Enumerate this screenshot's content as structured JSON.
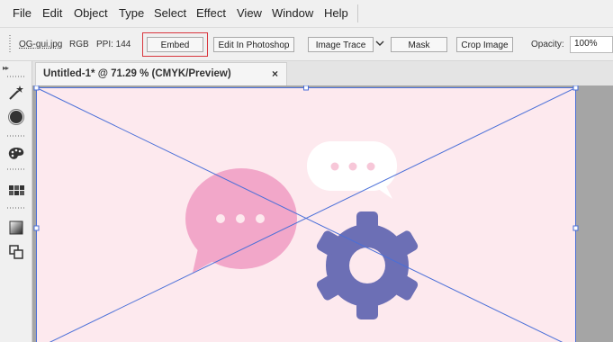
{
  "menu": {
    "items": [
      "File",
      "Edit",
      "Object",
      "Type",
      "Select",
      "Effect",
      "View",
      "Window",
      "Help"
    ]
  },
  "control_bar": {
    "filename": "OG-gui.jpg",
    "color_mode": "RGB",
    "ppi": "PPI: 144",
    "embed_label": "Embed",
    "edit_photoshop_label": "Edit In Photoshop",
    "image_trace_label": "Image Trace",
    "mask_label": "Mask",
    "crop_label": "Crop Image",
    "opacity_label": "Opacity:",
    "opacity_value": "100%"
  },
  "tools": {
    "collapse": "▸▸",
    "icons": [
      "magic-wand-icon",
      "blob-brush-icon",
      "color-palette-icon",
      "swatches-icon",
      "gradient-icon",
      "arrange-icon"
    ]
  },
  "document": {
    "tab_title": "Untitled-1* @ 71.29 % (CMYK/Preview)",
    "close": "×"
  },
  "colors": {
    "artboard": "#fde9ee",
    "pink_bubble": "#f2a7c9",
    "white_bubble": "#ffffff",
    "gear": "#6c6fb5",
    "selection": "#4a6fd8",
    "embed_highlight": "#d9363e"
  }
}
